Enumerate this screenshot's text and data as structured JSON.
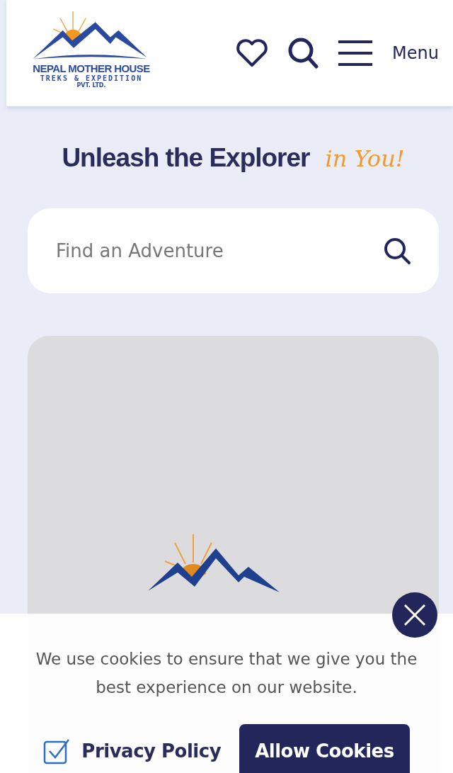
{
  "header": {
    "logo": {
      "name": "NEPAL MOTHER HOUSE",
      "tagline": "TREKS & EXPEDITION",
      "suffix": "PVT. LTD."
    },
    "menu_label": "Menu"
  },
  "hero": {
    "title": "Unleash the Explorer",
    "accent": "in You!"
  },
  "search": {
    "placeholder": "Find an Adventure"
  },
  "cookie_notice": {
    "message": "We use cookies to ensure that we give you the best experience on our website.",
    "privacy": {
      "label": "Privacy Policy",
      "checked": true
    },
    "button": "Allow Cookies"
  }
}
